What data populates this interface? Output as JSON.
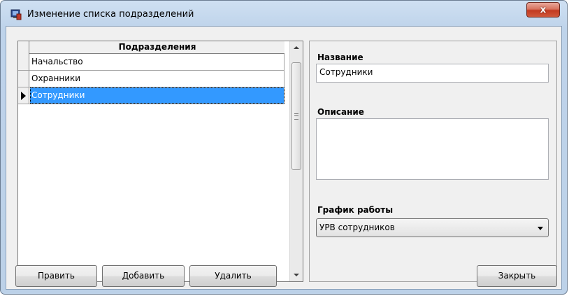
{
  "window": {
    "title": "Изменение списка подразделений",
    "close_label": "x",
    "icon": "app-window-icon"
  },
  "grid": {
    "column_header": "Подразделения",
    "rows": [
      {
        "label": "Начальство",
        "selected": false
      },
      {
        "label": "Охранники",
        "selected": false
      },
      {
        "label": "Сотрудники",
        "selected": true
      }
    ],
    "selection_color": "#3399ff"
  },
  "details": {
    "name_label": "Название",
    "name_value": "Сотрудники",
    "description_label": "Описание",
    "description_value": "",
    "schedule_label": "График работы",
    "schedule_value": "УРВ сотрудников"
  },
  "buttons": {
    "edit": "Править",
    "add": "Добавить",
    "delete": "Удалить",
    "close": "Закрыть"
  }
}
